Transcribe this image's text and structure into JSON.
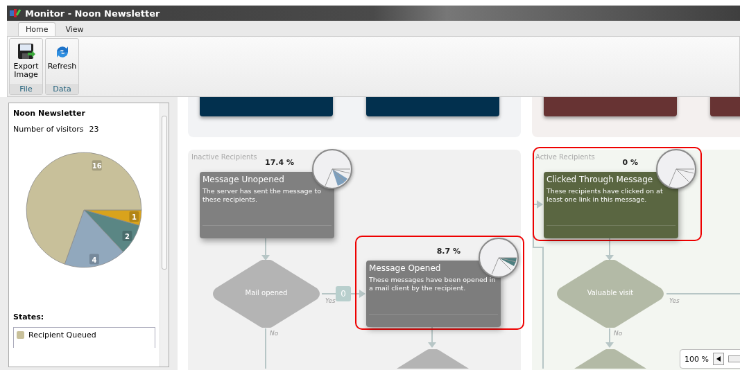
{
  "window": {
    "title": "Monitor - Noon Newsletter"
  },
  "tabs": [
    {
      "label": "Home",
      "selected": true
    },
    {
      "label": "View",
      "selected": false
    }
  ],
  "ribbon": [
    {
      "label": "File",
      "buttons": [
        {
          "label": "Export Image",
          "kind": "save"
        }
      ]
    },
    {
      "label": "Data",
      "buttons": [
        {
          "label": "Refresh",
          "kind": "refresh"
        }
      ]
    }
  ],
  "sidebar": {
    "title": "Noon Newsletter",
    "visitors_label": "Number of visitors",
    "visitors_count": "23",
    "chart_data": {
      "type": "pie",
      "values": [
        1,
        2,
        4,
        16
      ],
      "data_labels": true
    },
    "states_label": "States:",
    "states": [
      {
        "label": "Recipient Queued",
        "color": "#c8c09a"
      }
    ]
  },
  "canvas": {
    "top_nodes": [
      {
        "color": "#02304e"
      },
      {
        "color": "#02304e"
      },
      {
        "color": "#673333"
      },
      {
        "color": "#673333"
      }
    ],
    "lanes": [
      {
        "title": "Inactive Recipients"
      },
      {
        "title": "Active Recipients"
      }
    ],
    "nodes": [
      {
        "title": "Message Unopened",
        "description": "The server has sent the message to these recipients.",
        "percent": "17.4 %",
        "color": "#808080",
        "highlighted": false
      },
      {
        "title": "Message Opened",
        "description": "These messages have been opened in a mail client by the recipient.",
        "percent": "8.7 %",
        "color": "#7d7d7d",
        "highlighted": true
      },
      {
        "title": "Clicked Through Message",
        "description": "These recipients have clicked on at least one link in this message.",
        "percent": "0 %",
        "color": "#5a6641",
        "highlighted": true
      }
    ],
    "decisions": [
      {
        "label": "Mail opened",
        "yes": "Yes",
        "no": "No",
        "kind": "inactive"
      },
      {
        "label": "Valuable visit",
        "yes": "Yes",
        "no": "No",
        "kind": "active"
      }
    ],
    "counter": "0",
    "zoom": "100 %"
  }
}
